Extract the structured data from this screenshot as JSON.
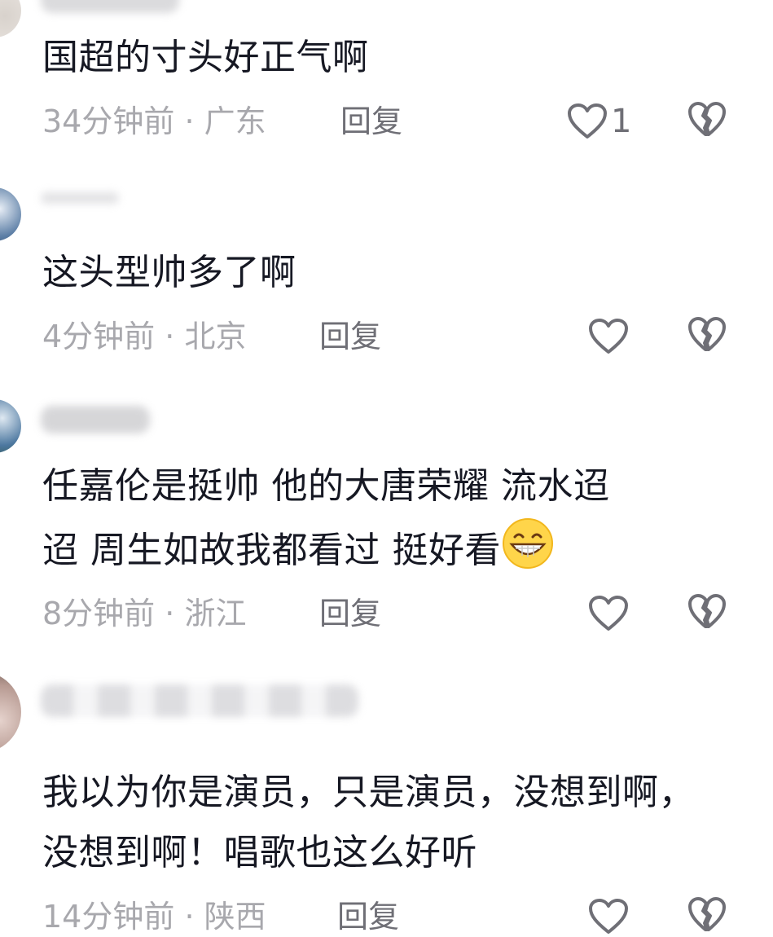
{
  "comments": [
    {
      "text": "国超的寸头好正气啊",
      "time": "34分钟前",
      "location": "广东",
      "reply_label": "回复",
      "likes": "1"
    },
    {
      "text": "这头型帅多了啊",
      "time": "4分钟前",
      "location": "北京",
      "reply_label": "回复",
      "likes": ""
    },
    {
      "text_line1": "任嘉伦是挺帅  他的大唐荣耀   流水迢",
      "text_line2": "迢   周生如故我都看过  挺好看",
      "emoji": "grinning-face-emoji",
      "time": "8分钟前",
      "location": "浙江",
      "reply_label": "回复",
      "likes": ""
    },
    {
      "text_line1": "我以为你是演员，只是演员，没想到啊，",
      "text_line2": "没想到啊！唱歌也这么好听",
      "time": "14分钟前",
      "location": "陕西",
      "reply_label": "回复",
      "likes": ""
    }
  ],
  "separator": " · ",
  "icons": {
    "like": "heart-outline-icon",
    "dislike": "broken-heart-icon"
  },
  "colors": {
    "text": "#161823",
    "meta": "#a8a8ad",
    "reply": "#6f6f76",
    "icon": "#6f6f76"
  }
}
